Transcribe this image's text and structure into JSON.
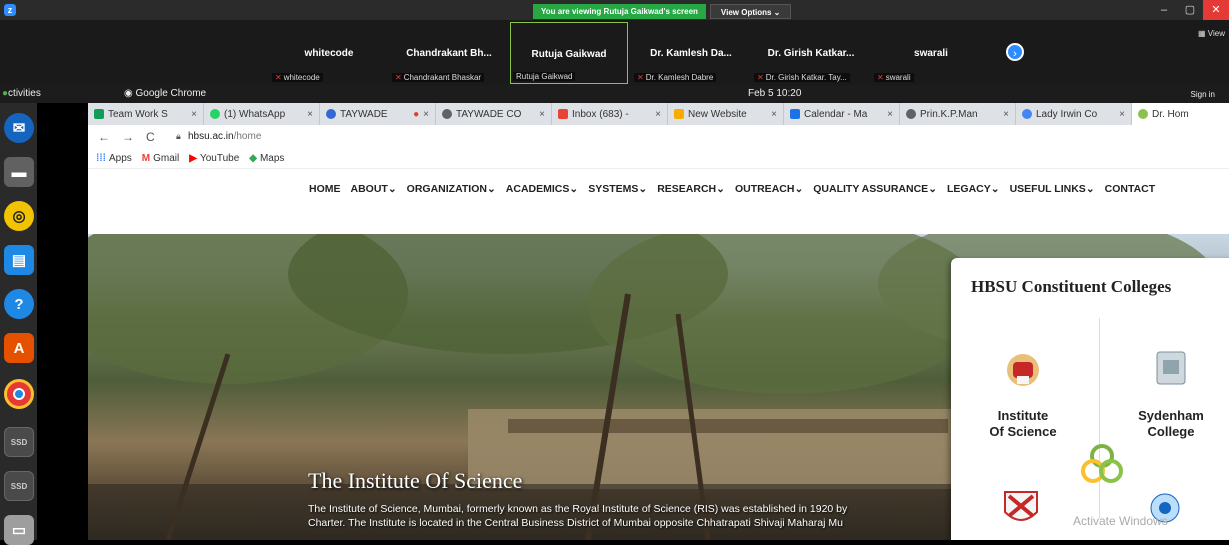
{
  "zoom": {
    "banner": "You are viewing Rutuja Gaikwad's screen",
    "view_options": "View Options",
    "view_label": "View",
    "participants": [
      {
        "big": "whitecode",
        "small": "whitecode"
      },
      {
        "big": "Chandrakant Bh...",
        "small": "Chandrakant Bhaskar"
      },
      {
        "big": "Rutuja Gaikwad",
        "small": "Rutuja Gaikwad"
      },
      {
        "big": "Dr. Kamlesh Da...",
        "small": "Dr. Kamlesh Dabre"
      },
      {
        "big": "Dr. Girish Katkar...",
        "small": "Dr. Girish Katkar. Tay..."
      },
      {
        "big": "swarali",
        "small": "swarali"
      }
    ]
  },
  "ubuntu": {
    "activities": "ctivities",
    "app_name": "Google Chrome",
    "clock": "Feb 5  10:20",
    "signin": "Sign in"
  },
  "dock": {
    "ssd1": "SSD",
    "ssd2": "SSD"
  },
  "browser": {
    "tabs": [
      {
        "label": "Team Work S",
        "color": "#0f9d58"
      },
      {
        "label": "(1) WhatsApp",
        "color": "#25d366"
      },
      {
        "label": "TAYWADE",
        "color": "#3367d6"
      },
      {
        "label": "TAYWADE CO",
        "color": "#5f6368"
      },
      {
        "label": "Inbox (683) -",
        "color": "#ea4335"
      },
      {
        "label": "New Website",
        "color": "#f9ab00"
      },
      {
        "label": "Calendar - Ma",
        "color": "#1a73e8"
      },
      {
        "label": "Prin.K.P.Man",
        "color": "#5f6368"
      },
      {
        "label": "Lady Irwin Co",
        "color": "#4285f4"
      },
      {
        "label": "Dr. Hom",
        "color": "#8bc34a"
      }
    ],
    "url_host": "hbsu.ac.in",
    "url_path": "/home",
    "bookmarks": {
      "apps": "Apps",
      "gmail": "Gmail",
      "youtube": "YouTube",
      "maps": "Maps"
    }
  },
  "site": {
    "nav": [
      "HOME",
      "ABOUT",
      "ORGANIZATION",
      "ACADEMICS",
      "SYSTEMS",
      "RESEARCH",
      "OUTREACH",
      "QUALITY ASSURANCE",
      "LEGACY",
      "USEFUL LINKS",
      "CONTACT"
    ],
    "hero_title": "The Institute Of Science",
    "hero_line1": "The Institute of Science, Mumbai, formerly known as the Royal Institute of Science (RIS) was established in 1920 by",
    "hero_line2": "Charter. The Institute is located in the Central Business District of Mumbai opposite Chhatrapati Shivaji Maharaj Mu",
    "card_title": "HBSU Constituent Colleges",
    "college1_line1": "Institute",
    "college1_line2": "Of Science",
    "college2_line1": "Sydenham",
    "college2_line2": "College",
    "watermark": "Activate Windows"
  }
}
